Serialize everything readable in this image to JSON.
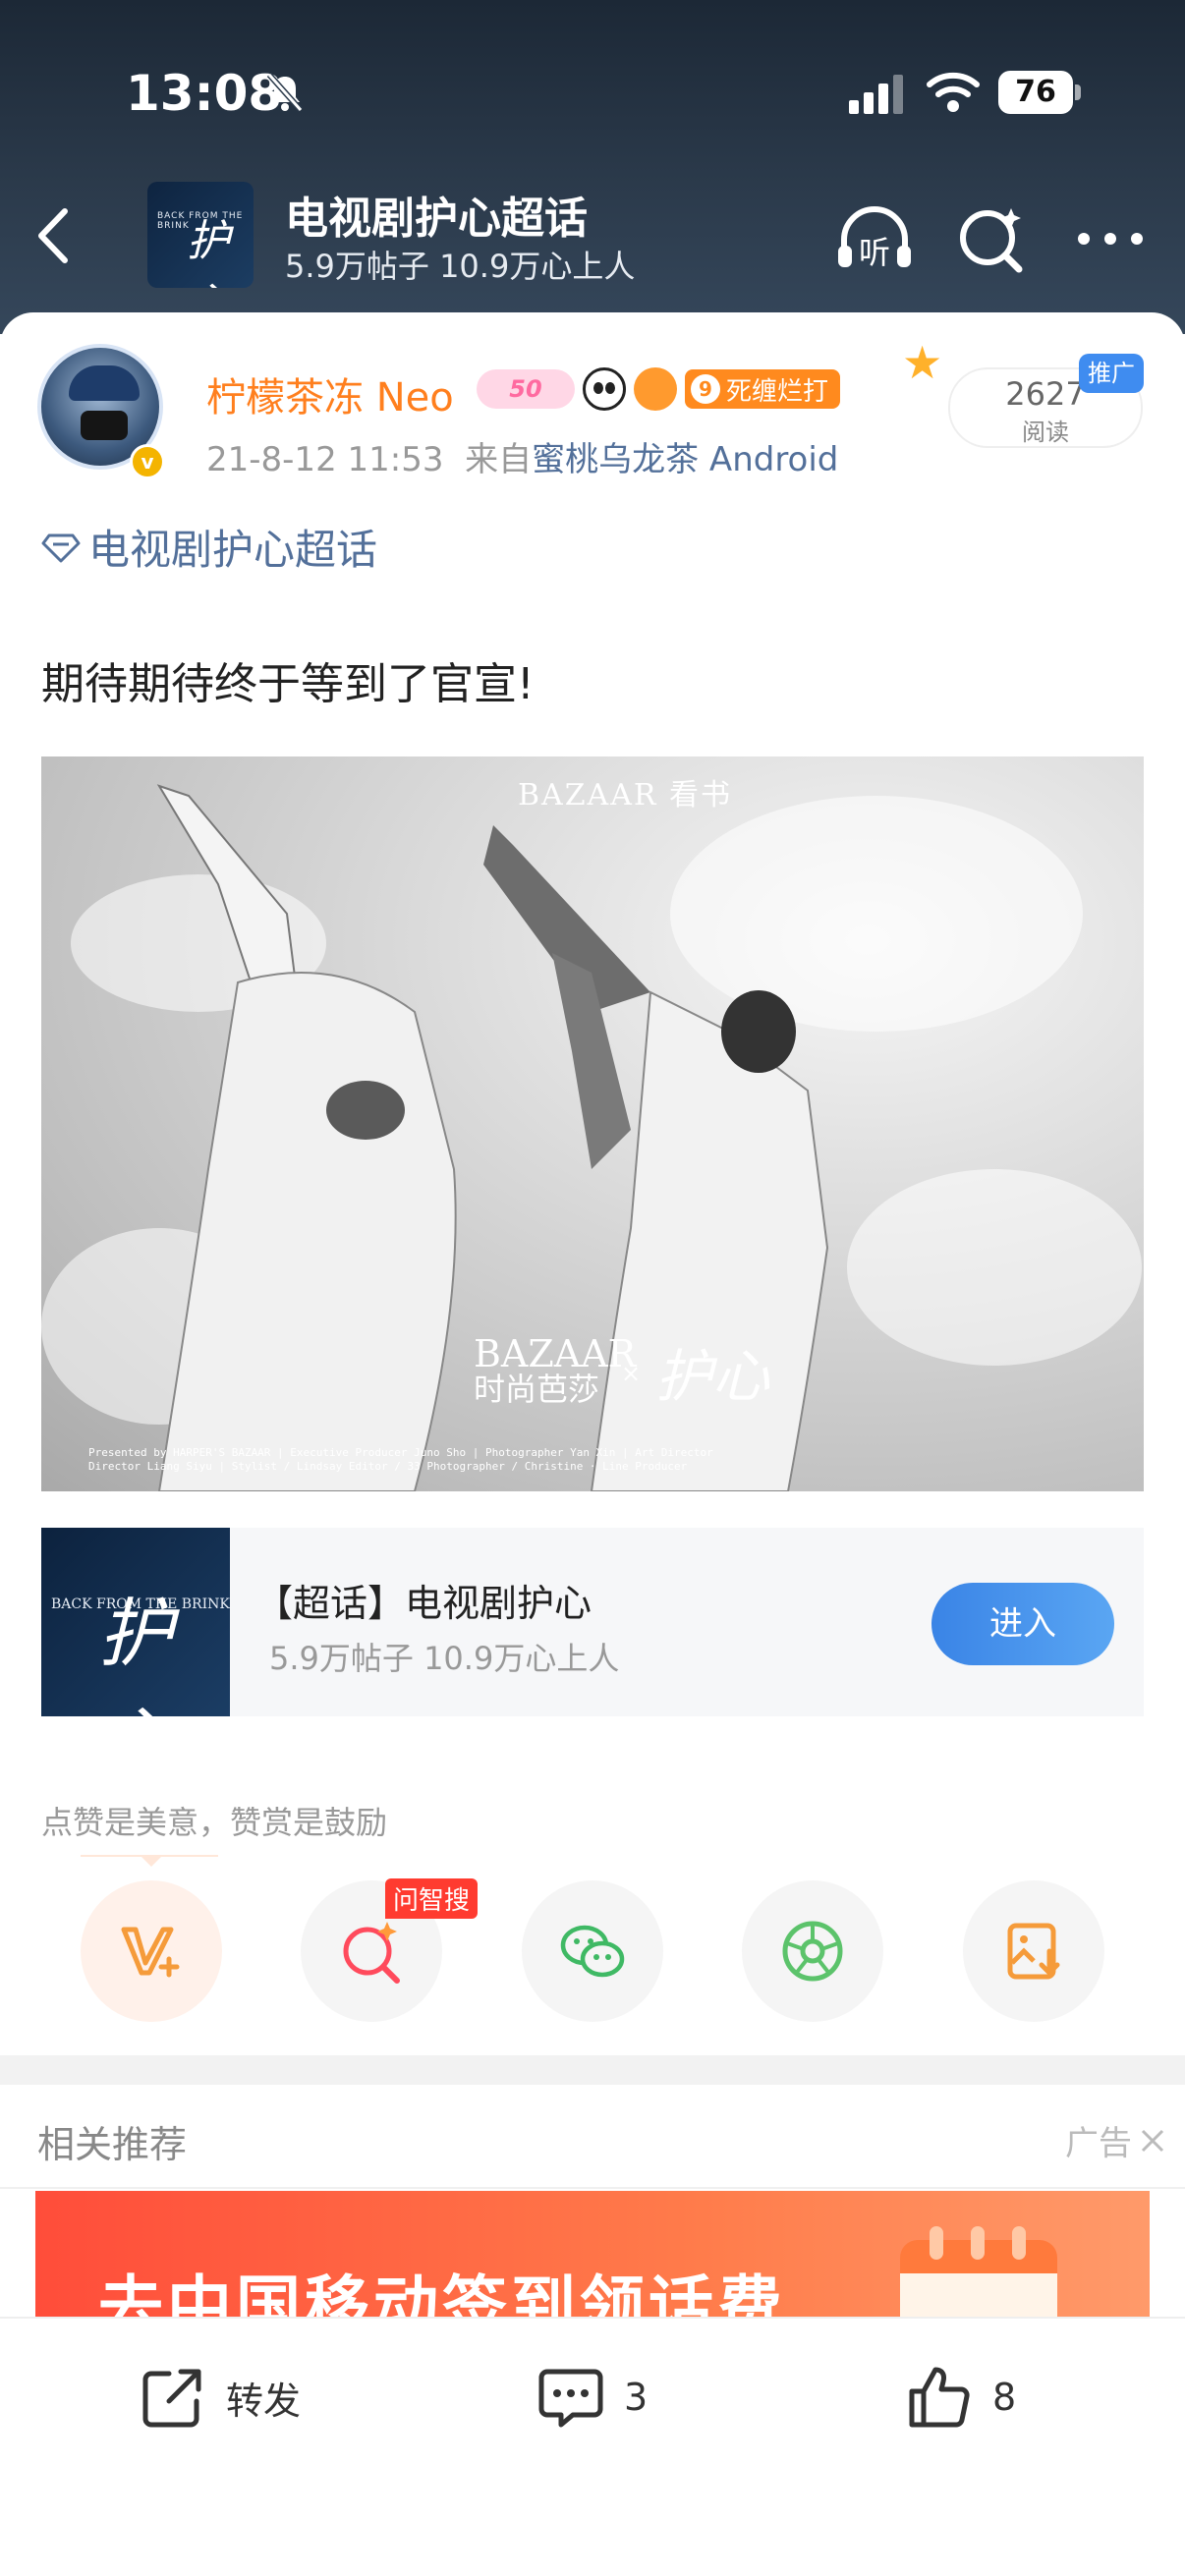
{
  "status_bar": {
    "time": "13:08",
    "battery": "76"
  },
  "header": {
    "title": "电视剧护心超话",
    "subtitle": "5.9万帖子 10.9万心上人",
    "listen_label": "听",
    "logo_small_text": "BACK FROM THE BRINK"
  },
  "post": {
    "username": "柠檬茶冻 Neo",
    "level_badge": "50",
    "fan_badge_num": "9",
    "fan_badge_label": "死缠烂打",
    "timestamp": "21-8-12 11:53",
    "source_prefix": "来自",
    "source": "蜜桃乌龙茶 Android",
    "read_count": "2627",
    "read_label": "阅读",
    "promo_label": "推广",
    "topic_link": "电视剧护心超话",
    "text": "期待期待终于等到了官宣!",
    "photo": {
      "brand": "BAZAAR 看书",
      "logo_en": "BAZAAR",
      "logo_cn": "时尚芭莎",
      "x": "×",
      "script": "护心",
      "credits_1": "Presented by HARPER'S BAZAAR | Executive Producer Juno Sho | Photographer Yan Xin | Art Director",
      "credits_2": "Director Liang Siyu | Stylist / Lindsay Editor / 33 Photographer / Christine · Line Producer"
    }
  },
  "topic_card": {
    "title": "【超话】电视剧护心",
    "stats": "5.9万帖子 10.9万心上人",
    "enter_label": "进入",
    "logo_small_text": "BACK FROM THE BRINK",
    "logo_script": "护心"
  },
  "reward": {
    "hint": "点赞是美意，赞赏是鼓励",
    "ai_tag": "问智搜"
  },
  "recommend": {
    "title": "相关推荐",
    "ad_label": "广告",
    "banner_text": "去中国移动签到领话费"
  },
  "bottom_bar": {
    "share_label": "转发",
    "comment_count": "3",
    "like_count": "8"
  },
  "colors": {
    "accent_orange": "#ff7f1e",
    "link_blue": "#53709a",
    "enter_blue": "#3a84e6"
  }
}
